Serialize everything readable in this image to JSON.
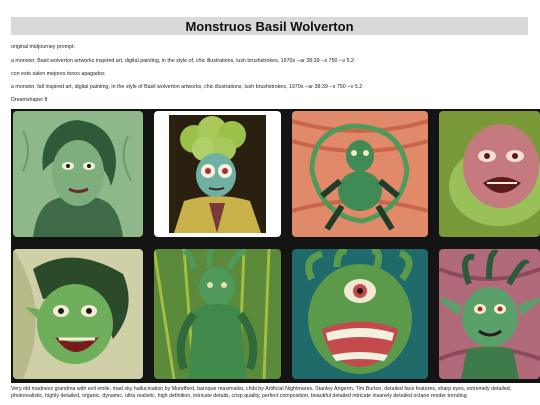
{
  "document": {
    "title": "Monstruos Basil Wolverton",
    "lines": [
      "original midjourney prompt:",
      "a monster, Basil wolverton artworks inspired art, digital painting, in the style of, chic illustrations, lush brushstrokes, 1970s --ar 38:39 --s 750 --v 5.2",
      "con este salen mejores tonos apagados",
      "a monster, fall inspired art, digital painting, in the style of Basil wolverton artworks, chic illustrations, lush brushstrokes, 1970s --ar 38:39 --s 750 --v 5.2",
      "Dreamshaper 8"
    ],
    "footer": "Very old madness grandma with evil smile, mad sky hallucination by Mundford, baroque maximalist, chibi by Artificial Nightmares, Stanley Artgerm, Tim Burton, detailed face features, sharp eyes, extremely detailed, photorealistic, highly detailed, organic, dynamic, ultra realistic, high definition, intricate details, crisp quality, perfect composition, beautiful detailed intricate insanely detailed octane render trending"
  },
  "gallery": {
    "images": [
      {
        "subject": "green-haired woman portrait",
        "bg": "#8fb88a",
        "skin": "#7fae7e",
        "accent": "#2e5a3a"
      },
      {
        "subject": "broccoli-haired man in suit",
        "bg": "#2a2010",
        "skin": "#6fb0a2",
        "accent": "#c9b24a"
      },
      {
        "subject": "crouching green monster",
        "bg": "#e08a6a",
        "skin": "#3f8a55",
        "accent": "#1e3d28"
      },
      {
        "subject": "screaming pink-green face",
        "bg": "#7a9a3a",
        "skin": "#c57a80",
        "accent": "#4a7a3a"
      },
      {
        "subject": "laughing green witch",
        "bg": "#cfd0a8",
        "skin": "#6fae5a",
        "accent": "#2a4a2a"
      },
      {
        "subject": "tentacle green figure",
        "bg": "#5a8a3a",
        "skin": "#4f9a5a",
        "accent": "#d8e04a"
      },
      {
        "subject": "one-eyed grinning monster",
        "bg": "#1f6a6a",
        "skin": "#5a9a4a",
        "accent": "#c24a4a"
      },
      {
        "subject": "green goblin with tentacle hair",
        "bg": "#b06a7a",
        "skin": "#5aa06a",
        "accent": "#2f5a3a"
      }
    ]
  }
}
